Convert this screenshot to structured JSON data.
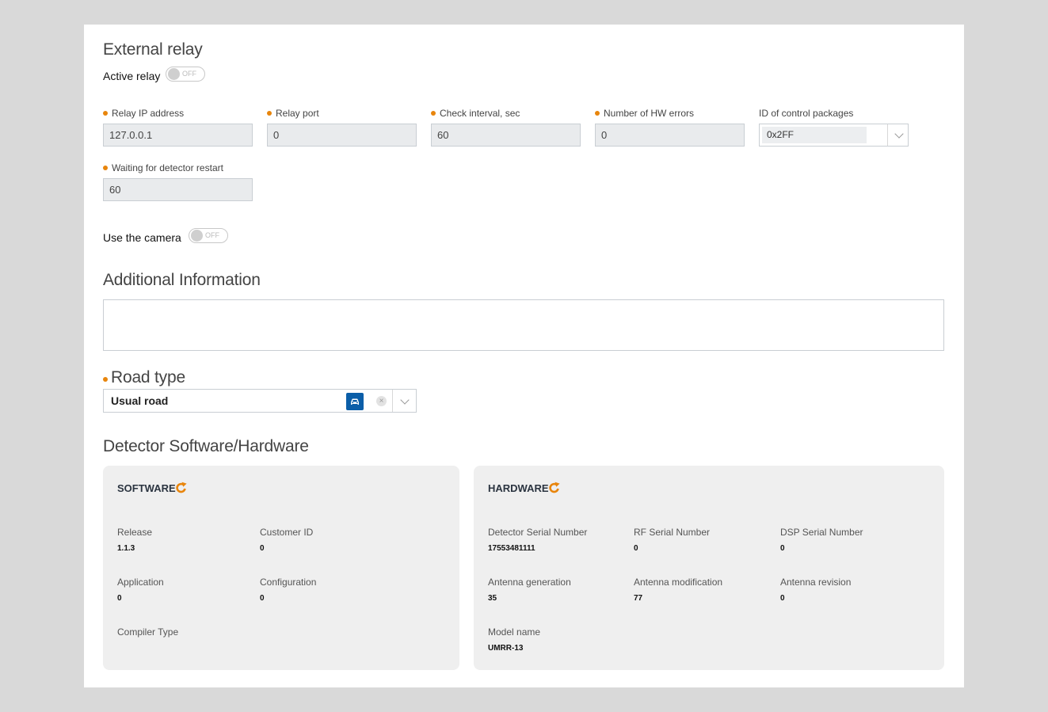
{
  "external_relay": {
    "title": "External relay",
    "active_relay_label": "Active relay",
    "active_relay_state": "OFF",
    "fields": [
      {
        "label": "Relay IP address",
        "value": "127.0.0.1",
        "required": true
      },
      {
        "label": "Relay port",
        "value": "0",
        "required": true
      },
      {
        "label": "Check interval, sec",
        "value": "60",
        "required": true
      },
      {
        "label": "Number of HW errors",
        "value": "0",
        "required": true
      },
      {
        "label": "ID of control packages",
        "value": "0x2FF",
        "required": false
      },
      {
        "label": "Waiting for detector restart",
        "value": "60",
        "required": true
      }
    ]
  },
  "camera": {
    "label": "Use the camera",
    "state": "OFF"
  },
  "additional_info": {
    "title": "Additional Information",
    "value": ""
  },
  "road_type": {
    "title": "Road type",
    "value": "Usual road",
    "icon": "car-icon",
    "accent": "#0b5ea8"
  },
  "detector": {
    "title": "Detector Software/Hardware",
    "software": {
      "title": "SOFTWARE",
      "items": [
        {
          "label": "Release",
          "value": "1.1.3"
        },
        {
          "label": "Customer ID",
          "value": "0"
        },
        {
          "label": "Application",
          "value": "0"
        },
        {
          "label": "Configuration",
          "value": "0"
        },
        {
          "label": "Compiler Type",
          "value": ""
        }
      ]
    },
    "hardware": {
      "title": "HARDWARE",
      "items": [
        {
          "label": "Detector Serial Number",
          "value": "17553481111"
        },
        {
          "label": "RF Serial Number",
          "value": "0"
        },
        {
          "label": "DSP Serial Number",
          "value": "0"
        },
        {
          "label": "Antenna generation",
          "value": "35"
        },
        {
          "label": "Antenna modification",
          "value": "77"
        },
        {
          "label": "Antenna revision",
          "value": "0"
        },
        {
          "label": "Model name",
          "value": "UMRR-13"
        }
      ]
    }
  },
  "colors": {
    "required_dot": "#e8850c",
    "refresh_icon": "#e8850c",
    "card_bg": "#efefef",
    "page_bg": "#d9d9d9"
  }
}
